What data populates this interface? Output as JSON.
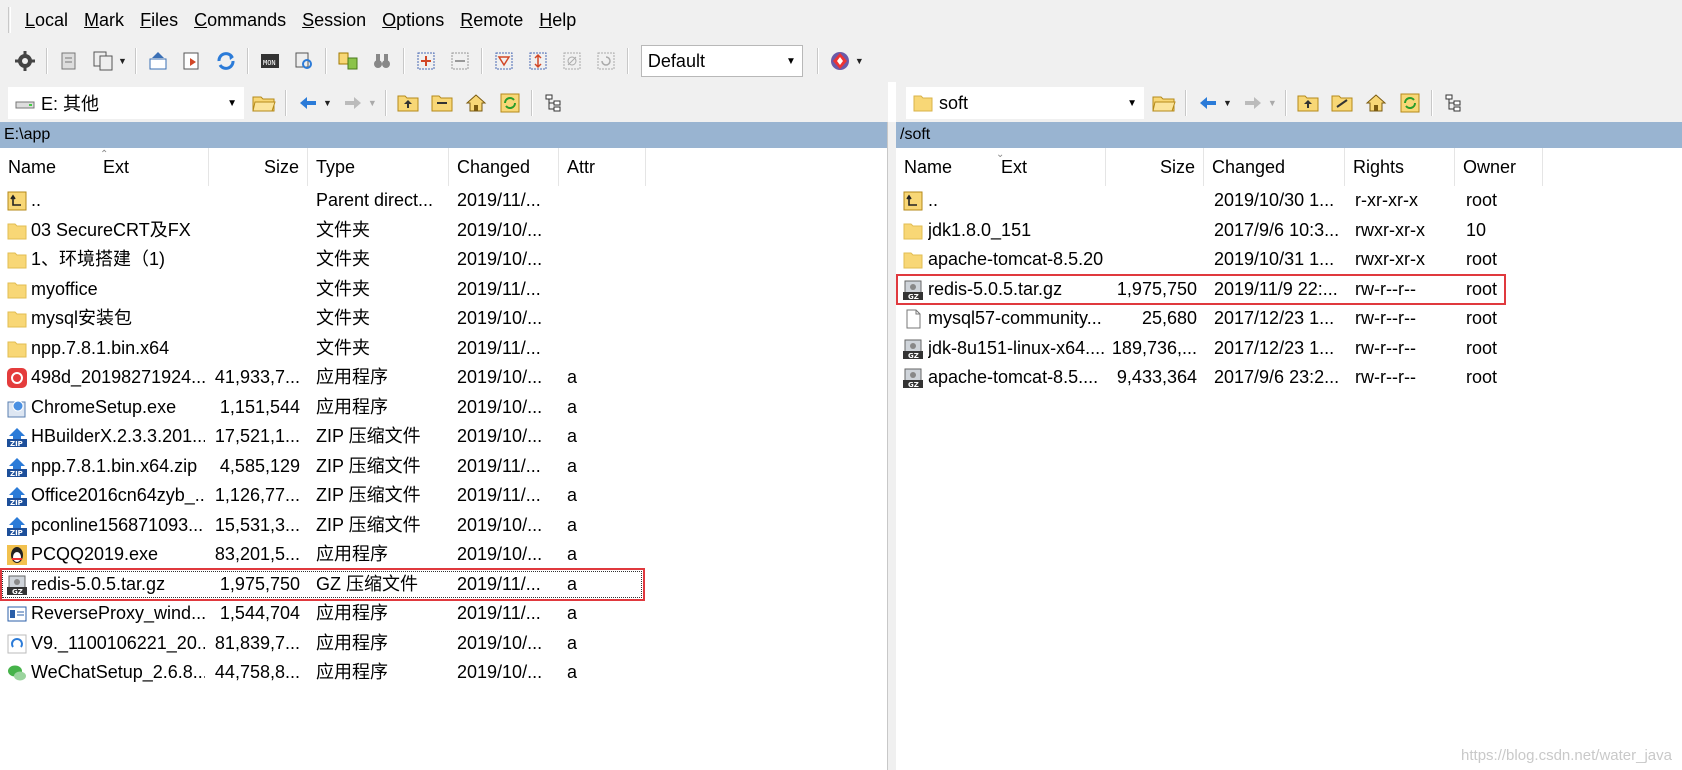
{
  "menu": [
    {
      "label": "Local",
      "key": "L",
      "rest": "ocal"
    },
    {
      "label": "Mark",
      "key": "M",
      "rest": "ark"
    },
    {
      "label": "Files",
      "key": "F",
      "rest": "iles"
    },
    {
      "label": "Commands",
      "key": "C",
      "rest": "ommands"
    },
    {
      "label": "Session",
      "key": "S",
      "rest": "ession"
    },
    {
      "label": "Options",
      "key": "O",
      "rest": "ptions"
    },
    {
      "label": "Remote",
      "key": "R",
      "rest": "emote"
    },
    {
      "label": "Help",
      "key": "H",
      "rest": "elp"
    }
  ],
  "toolbar": {
    "session_combo": "Default"
  },
  "left": {
    "drive": "E: 其他",
    "path": "E:\\app",
    "columns": [
      "Name",
      "Ext",
      "Size",
      "Type",
      "Changed",
      "Attr"
    ],
    "rows": [
      {
        "icon": "parent-dir-icon",
        "name": "..",
        "size": "",
        "type": "Parent direct...",
        "changed": "2019/11/...",
        "attr": ""
      },
      {
        "icon": "folder-icon",
        "name": "03 SecureCRT及FX",
        "size": "",
        "type": "文件夹",
        "changed": "2019/10/...",
        "attr": ""
      },
      {
        "icon": "folder-icon",
        "name": "1、环境搭建（1)",
        "size": "",
        "type": "文件夹",
        "changed": "2019/10/...",
        "attr": ""
      },
      {
        "icon": "folder-icon",
        "name": "myoffice",
        "size": "",
        "type": "文件夹",
        "changed": "2019/11/...",
        "attr": ""
      },
      {
        "icon": "folder-icon",
        "name": "mysql安装包",
        "size": "",
        "type": "文件夹",
        "changed": "2019/10/...",
        "attr": ""
      },
      {
        "icon": "folder-icon",
        "name": "npp.7.8.1.bin.x64",
        "size": "",
        "type": "文件夹",
        "changed": "2019/11/...",
        "attr": ""
      },
      {
        "icon": "music-app-icon",
        "name": "498d_20198271924...",
        "size": "41,933,7...",
        "type": "应用程序",
        "changed": "2019/10/...",
        "attr": "a"
      },
      {
        "icon": "setup-exe-icon",
        "name": "ChromeSetup.exe",
        "size": "1,151,544",
        "type": "应用程序",
        "changed": "2019/10/...",
        "attr": "a"
      },
      {
        "icon": "zip-icon",
        "name": "HBuilderX.2.3.3.201...",
        "size": "17,521,1...",
        "type": "ZIP 压缩文件",
        "changed": "2019/10/...",
        "attr": "a"
      },
      {
        "icon": "zip-icon",
        "name": "npp.7.8.1.bin.x64.zip",
        "size": "4,585,129",
        "type": "ZIP 压缩文件",
        "changed": "2019/11/...",
        "attr": "a"
      },
      {
        "icon": "zip-icon",
        "name": "Office2016cn64zyb_...",
        "size": "1,126,77...",
        "type": "ZIP 压缩文件",
        "changed": "2019/11/...",
        "attr": "a"
      },
      {
        "icon": "zip-icon",
        "name": "pconline156871093...",
        "size": "15,531,3...",
        "type": "ZIP 压缩文件",
        "changed": "2019/10/...",
        "attr": "a"
      },
      {
        "icon": "qq-icon",
        "name": "PCQQ2019.exe",
        "size": "83,201,5...",
        "type": "应用程序",
        "changed": "2019/10/...",
        "attr": "a"
      },
      {
        "icon": "gz-icon",
        "name": "redis-5.0.5.tar.gz",
        "size": "1,975,750",
        "type": "GZ 压缩文件",
        "changed": "2019/11/...",
        "attr": "a"
      },
      {
        "icon": "window-app-icon",
        "name": "ReverseProxy_wind...",
        "size": "1,544,704",
        "type": "应用程序",
        "changed": "2019/11/...",
        "attr": "a"
      },
      {
        "icon": "circle-app-icon",
        "name": "V9._1100106221_20...",
        "size": "81,839,7...",
        "type": "应用程序",
        "changed": "2019/10/...",
        "attr": "a"
      },
      {
        "icon": "wechat-icon",
        "name": "WeChatSetup_2.6.8....",
        "size": "44,758,8...",
        "type": "应用程序",
        "changed": "2019/10/...",
        "attr": "a"
      }
    ]
  },
  "right": {
    "path_combo": "soft",
    "path": "/soft",
    "columns": [
      "Name",
      "Ext",
      "Size",
      "Changed",
      "Rights",
      "Owner"
    ],
    "rows": [
      {
        "icon": "parent-dir-icon",
        "name": "..",
        "size": "",
        "changed": "2019/10/30 1...",
        "rights": "r-xr-xr-x",
        "owner": "root"
      },
      {
        "icon": "folder-icon",
        "name": "jdk1.8.0_151",
        "size": "",
        "changed": "2017/9/6 10:3...",
        "rights": "rwxr-xr-x",
        "owner": "10"
      },
      {
        "icon": "folder-icon",
        "name": "apache-tomcat-8.5.20",
        "size": "",
        "changed": "2019/10/31 1...",
        "rights": "rwxr-xr-x",
        "owner": "root"
      },
      {
        "icon": "gz-icon",
        "name": "redis-5.0.5.tar.gz",
        "size": "1,975,750",
        "changed": "2019/11/9 22:...",
        "rights": "rw-r--r--",
        "owner": "root"
      },
      {
        "icon": "file-icon",
        "name": "mysql57-community...",
        "size": "25,680",
        "changed": "2017/12/23 1...",
        "rights": "rw-r--r--",
        "owner": "root"
      },
      {
        "icon": "gz-icon",
        "name": "jdk-8u151-linux-x64....",
        "size": "189,736,...",
        "changed": "2017/12/23 1...",
        "rights": "rw-r--r--",
        "owner": "root"
      },
      {
        "icon": "gz-icon",
        "name": "apache-tomcat-8.5....",
        "size": "9,433,364",
        "changed": "2017/9/6 23:2...",
        "rights": "rw-r--r--",
        "owner": "root"
      }
    ]
  },
  "watermark": "https://blog.csdn.net/water_java",
  "colors": {
    "path_strip": "#99b4d1",
    "highlight": "#e0393e",
    "folder": "#f8d776",
    "chrome": "#f0f0f0"
  }
}
